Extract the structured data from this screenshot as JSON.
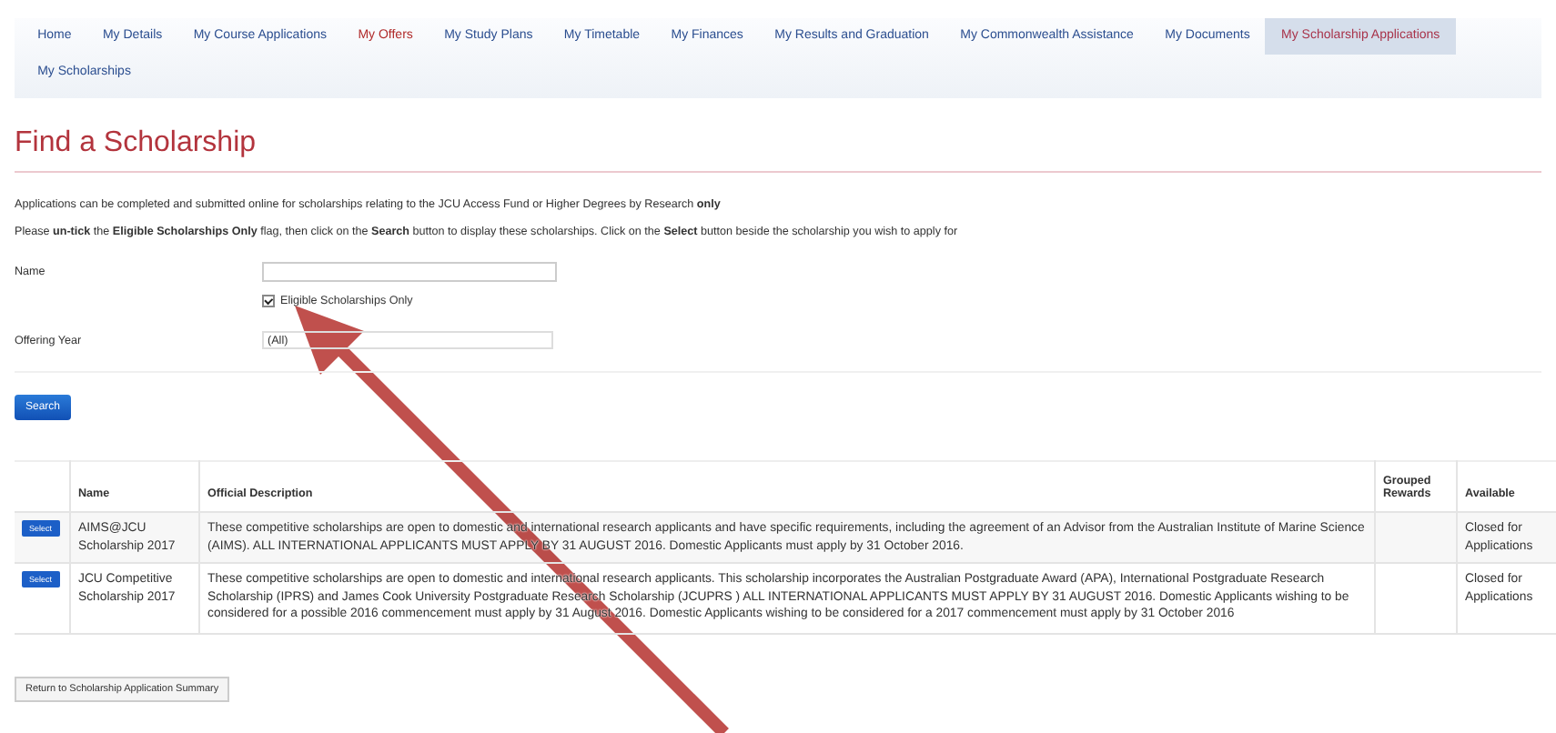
{
  "nav": [
    {
      "label": "Home",
      "selected": false,
      "highlighted": false
    },
    {
      "label": "My Details",
      "selected": false,
      "highlighted": false
    },
    {
      "label": "My Course Applications",
      "selected": false,
      "highlighted": false
    },
    {
      "label": "My Offers",
      "selected": false,
      "highlighted": true
    },
    {
      "label": "My Study Plans",
      "selected": false,
      "highlighted": false
    },
    {
      "label": "My Timetable",
      "selected": false,
      "highlighted": false
    },
    {
      "label": "My Finances",
      "selected": false,
      "highlighted": false
    },
    {
      "label": "My Results and Graduation",
      "selected": false,
      "highlighted": false
    },
    {
      "label": "My Commonwealth Assistance",
      "selected": false,
      "highlighted": false
    },
    {
      "label": "My Documents",
      "selected": false,
      "highlighted": false
    },
    {
      "label": "My Scholarship Applications",
      "selected": true,
      "highlighted": false
    },
    {
      "label": "My Scholarships",
      "selected": false,
      "highlighted": false
    }
  ],
  "title": "Find a Scholarship",
  "intro": [
    "Applications can be completed and submitted online for scholarships relating to the JCU Access Fund or Higher Degrees by Research **only**",
    "Please **un-tick** the **Eligible Scholarships Only** flag, then click on the **Search** button to display these scholarships. Click on the **Select** button beside the scholarship you wish to apply for"
  ],
  "form": {
    "name_label": "Name",
    "eligible_label": "Eligible Scholarships Only",
    "eligible_checked": true,
    "year_label": "Offering Year",
    "year_value": "(All)",
    "search_button": "Search"
  },
  "table": {
    "columns": [
      "Name",
      "Official Description",
      "Grouped Rewards",
      "Available"
    ],
    "rows": [
      {
        "button": "Select",
        "name": "AIMS@JCU Scholarship 2017",
        "description": "These competitive scholarships are open to domestic and international research applicants and have specific requirements, including the agreement of an Advisor from the Australian Institute of Marine Science (AIMS). ALL INTERNATIONAL APPLICANTS MUST APPLY BY 31 AUGUST 2016. Domestic Applicants must apply by 31 October 2016.",
        "available": "Closed for Applications"
      },
      {
        "button": "Select",
        "name": "JCU Competitive Scholarship 2017",
        "description": "These competitive scholarships are open to domestic and international research applicants. This scholarship incorporates the Australian Postgraduate Award (APA), International Postgraduate Research Scholarship (IPRS) and James Cook University Postgraduate Research Scholarship (JCUPRS ) ALL INTERNATIONAL APPLICANTS MUST APPLY BY 31 AUGUST 2016. Domestic Applicants wishing to be considered for a possible 2016 commencement must apply by 31 August 2016. Domestic Applicants wishing to be considered for a 2017 commencement must apply by 31 October 2016",
        "available": "Closed for Applications"
      }
    ]
  },
  "return_button": "Return to Scholarship Application Summary"
}
